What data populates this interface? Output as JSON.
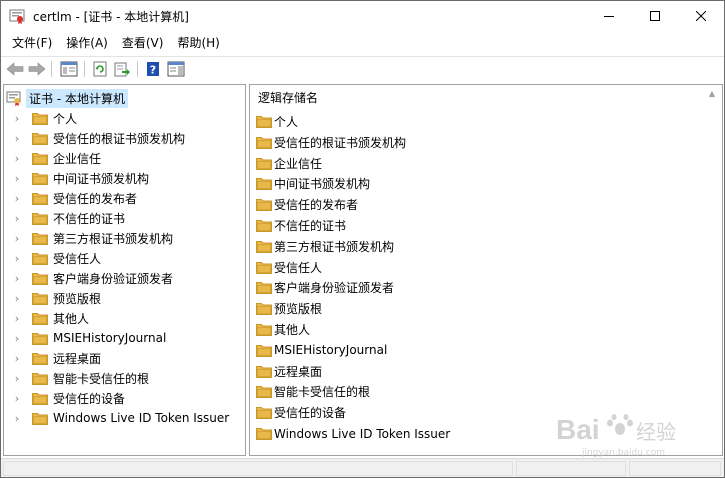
{
  "window": {
    "title": "certlm - [证书 - 本地计算机]",
    "controls": {
      "minimize": "—",
      "maximize": "☐",
      "close": "✕"
    }
  },
  "menu": {
    "items": [
      "文件(F)",
      "操作(A)",
      "查看(V)",
      "帮助(H)"
    ]
  },
  "toolbar": {
    "buttons": [
      "back-icon",
      "forward-icon",
      "show-hide-console-tree-icon",
      "refresh-icon",
      "export-list-icon",
      "help-icon",
      "action-pane-icon"
    ]
  },
  "tree": {
    "root_label": "证书 - 本地计算机",
    "items": [
      "个人",
      "受信任的根证书颁发机构",
      "企业信任",
      "中间证书颁发机构",
      "受信任的发布者",
      "不信任的证书",
      "第三方根证书颁发机构",
      "受信任人",
      "客户端身份验证颁发者",
      "预览版根",
      "其他人",
      "MSIEHistoryJournal",
      "远程桌面",
      "智能卡受信任的根",
      "受信任的设备",
      "Windows Live ID Token Issuer"
    ]
  },
  "list": {
    "column_header": "逻辑存储名",
    "items": [
      "个人",
      "受信任的根证书颁发机构",
      "企业信任",
      "中间证书颁发机构",
      "受信任的发布者",
      "不信任的证书",
      "第三方根证书颁发机构",
      "受信任人",
      "客户端身份验证颁发者",
      "预览版根",
      "其他人",
      "MSIEHistoryJournal",
      "远程桌面",
      "智能卡受信任的根",
      "受信任的设备",
      "Windows Live ID Token Issuer"
    ]
  },
  "watermark": {
    "brand": "Bai",
    "brand2": "经验",
    "sub": "jingyan.baidu.com"
  },
  "colors": {
    "folder": "#e8b84a",
    "folder_dark": "#c9962a",
    "selection": "#cce8ff",
    "help": "#1e4fb0"
  }
}
